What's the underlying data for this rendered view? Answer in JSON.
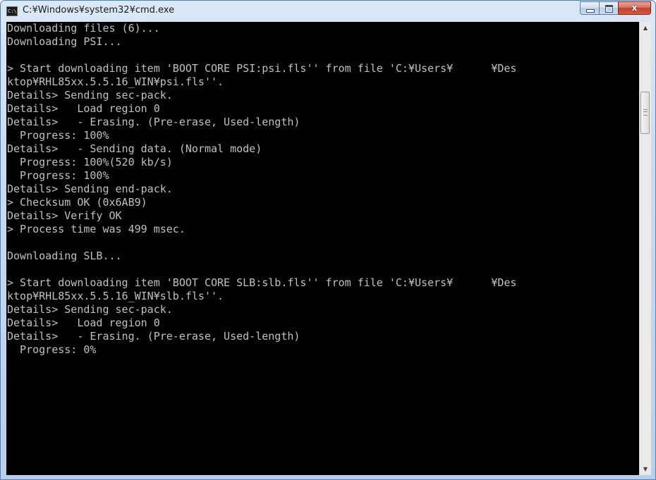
{
  "window": {
    "title": "C:¥Windows¥system32¥cmd.exe",
    "icon": "cmd-icon",
    "icon_text": "C:\\"
  },
  "caption_buttons": {
    "minimize": "minimize-icon",
    "maximize": "maximize-icon",
    "close_label": "x"
  },
  "console": {
    "lines": [
      "Downloading files (6)...",
      "Downloading PSI...",
      "",
      "> Start downloading item 'BOOT CORE PSI:psi.fls'' from file 'C:¥Users¥      ¥Des",
      "ktop¥RHL85xx.5.5.16_WIN¥psi.fls''.",
      "Details> Sending sec-pack.",
      "Details>   Load region 0",
      "Details>   - Erasing. (Pre-erase, Used-length)",
      "  Progress: 100%",
      "Details>   - Sending data. (Normal mode)",
      "  Progress: 100%(520 kb/s)",
      "  Progress: 100%",
      "Details> Sending end-pack.",
      "> Checksum OK (0x6AB9)",
      "Details> Verify OK",
      "> Process time was 499 msec.",
      "",
      "Downloading SLB...",
      "",
      "> Start downloading item 'BOOT CORE SLB:slb.fls'' from file 'C:¥Users¥      ¥Des",
      "ktop¥RHL85xx.5.5.16_WIN¥slb.fls''.",
      "Details> Sending sec-pack.",
      "Details>   Load region 0",
      "Details>   - Erasing. (Pre-erase, Used-length)",
      "  Progress: 0%"
    ]
  },
  "scrollbar": {
    "up_arrow": "▲",
    "down_arrow": "▼",
    "position_fraction": 0.15
  },
  "colors": {
    "console_bg": "#000000",
    "console_text": "#c0c0c0",
    "close_button": "#c33f2a"
  }
}
